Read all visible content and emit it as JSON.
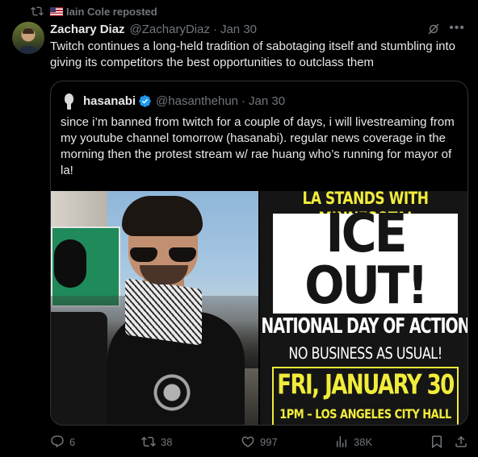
{
  "repost": {
    "icon": "retweet-icon",
    "flag": "us-flag-icon",
    "text": "Iain Cole reposted"
  },
  "tweet": {
    "author_name": "Zachary Diaz",
    "author_handle": "@ZacharyDiaz",
    "separator": "·",
    "date": "Jan 30",
    "text": "Twitch continues a long-held tradition of sabotaging itself and stumbling into giving its competitors the best opportunities to outclass them"
  },
  "quote": {
    "author_name": "hasanabi",
    "author_handle": "@hasanthehun",
    "separator": "·",
    "date": "Jan 30",
    "verified": true,
    "text": "since i’m banned from twitch for a couple of days, i will livestreaming from my youtube channel tomorrow (hasanabi). regular news coverage in the morning then the protest stream w/ rae huang who’s running for mayor of la!",
    "poster": {
      "headline": "LA STANDS WITH MINNESOTA!",
      "big_line_1": "ICE",
      "big_line_2": "OUT!",
      "subtitle": "NATIONAL DAY OF ACTION",
      "tagline": "NO BUSINESS AS USUAL!",
      "date": "FRI, JANUARY 30",
      "location": "1PM – LOS ANGELES CITY HALL"
    }
  },
  "actions": {
    "replies": "6",
    "reposts": "38",
    "likes": "997",
    "views": "38K"
  },
  "colors": {
    "background": "#000000",
    "text": "#e7e9ea",
    "muted": "#71767b",
    "border": "#2f3336",
    "verified": "#1d9bf0",
    "poster_yellow": "#f1ec3a"
  }
}
